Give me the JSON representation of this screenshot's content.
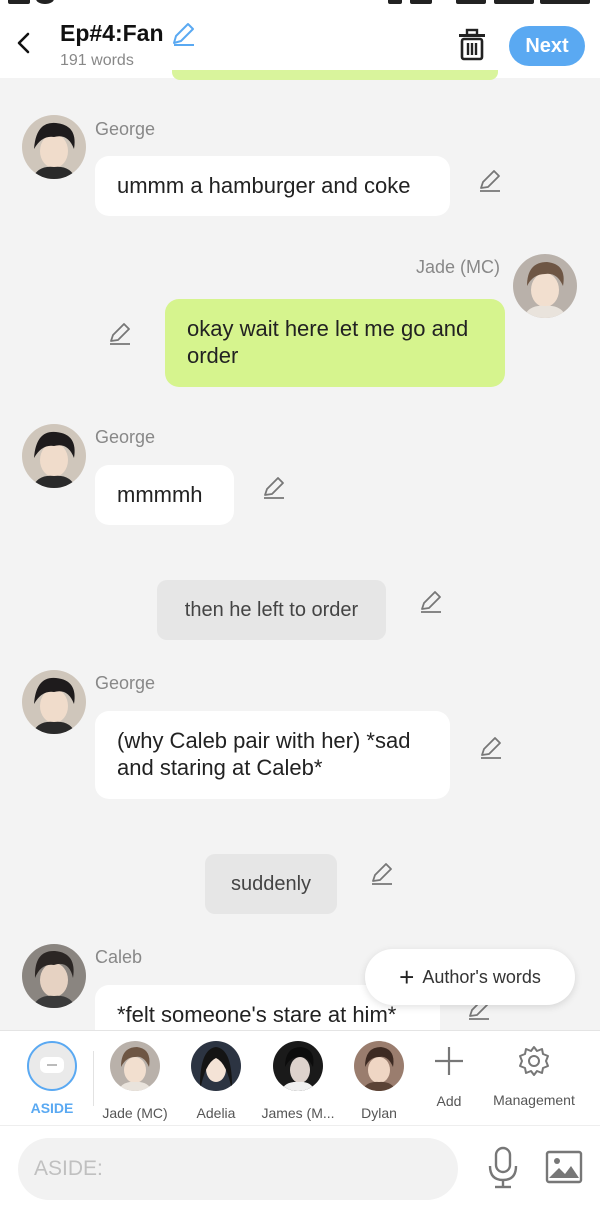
{
  "header": {
    "title": "Ep#4:Fan",
    "word_count": "191 words",
    "next_label": "Next"
  },
  "messages": [
    {
      "type": "char",
      "side": "left",
      "name": "George",
      "text": "ummm a hamburger and coke"
    },
    {
      "type": "char",
      "side": "right",
      "name": "Jade (MC)",
      "text": "okay wait here let me go and order"
    },
    {
      "type": "char",
      "side": "left",
      "name": "George",
      "text": "mmmmh"
    },
    {
      "type": "aside",
      "text": "then he left to order"
    },
    {
      "type": "char",
      "side": "left",
      "name": "George",
      "text": "(why Caleb pair with her) *sad and staring at Caleb*"
    },
    {
      "type": "aside",
      "text": "suddenly"
    },
    {
      "type": "char",
      "side": "left",
      "name": "Caleb",
      "text": "*felt someone's stare at him*"
    }
  ],
  "author_words_label": "Author's words",
  "characters": [
    {
      "label": "ASIDE",
      "selected": true
    },
    {
      "label": "Jade (MC)"
    },
    {
      "label": "Adelia"
    },
    {
      "label": "James (M..."
    },
    {
      "label": "Dylan"
    },
    {
      "label": "Add"
    },
    {
      "label": "Management"
    }
  ],
  "input": {
    "placeholder": "ASIDE:"
  },
  "colors": {
    "accent": "#5aa9f2",
    "mc_bubble": "#d6f48e",
    "aside_bubble": "#e6e6e6",
    "background": "#f3f3f3"
  },
  "icons": [
    "back-arrow-icon",
    "pencil-icon",
    "trash-icon",
    "plus-icon",
    "gear-icon",
    "microphone-icon",
    "image-icon"
  ]
}
